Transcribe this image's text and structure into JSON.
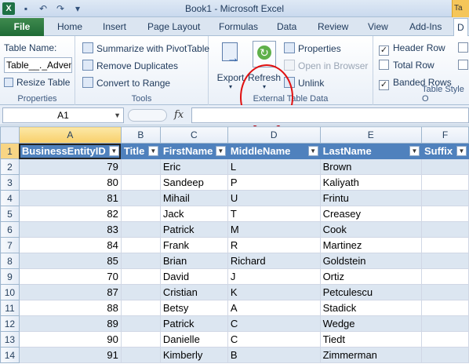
{
  "titlebar": {
    "app_icon": "X",
    "title": "Book1  -  Microsoft Excel",
    "context_tab": "Ta"
  },
  "tabs": {
    "file": "File",
    "items": [
      "Home",
      "Insert",
      "Page Layout",
      "Formulas",
      "Data",
      "Review",
      "View",
      "Add-Ins",
      "D"
    ]
  },
  "ribbon": {
    "properties": {
      "table_name_label": "Table Name:",
      "table_name_value": "Table__._Advent",
      "resize_label": "Resize Table",
      "group_label": "Properties"
    },
    "tools": {
      "summarize": "Summarize with PivotTable",
      "remove_duplicates": "Remove Duplicates",
      "convert": "Convert to Range",
      "group_label": "Tools"
    },
    "external": {
      "export": "Export",
      "refresh": "Refresh",
      "properties": "Properties",
      "open_in_browser": "Open in Browser",
      "unlink": "Unlink",
      "group_label": "External Table Data"
    },
    "style_options": {
      "header_row": "Header Row",
      "total_row": "Total Row",
      "banded_rows": "Banded Rows",
      "group_label": "Table Style O"
    }
  },
  "formula_bar": {
    "name_box": "A1",
    "fx": "fx",
    "formula": ""
  },
  "grid": {
    "columns": [
      "A",
      "B",
      "C",
      "D",
      "E",
      "F"
    ],
    "headers": [
      "BusinessEntityID",
      "Title",
      "FirstName",
      "MiddleName",
      "LastName",
      "Suffix"
    ],
    "rows": [
      {
        "num": "2",
        "cells": [
          "79",
          "",
          "Eric",
          "L",
          "Brown",
          ""
        ]
      },
      {
        "num": "3",
        "cells": [
          "80",
          "",
          "Sandeep",
          "P",
          "Kaliyath",
          ""
        ]
      },
      {
        "num": "4",
        "cells": [
          "81",
          "",
          "Mihail",
          "U",
          "Frintu",
          ""
        ]
      },
      {
        "num": "5",
        "cells": [
          "82",
          "",
          "Jack",
          "T",
          "Creasey",
          ""
        ]
      },
      {
        "num": "6",
        "cells": [
          "83",
          "",
          "Patrick",
          "M",
          "Cook",
          ""
        ]
      },
      {
        "num": "7",
        "cells": [
          "84",
          "",
          "Frank",
          "R",
          "Martinez",
          ""
        ]
      },
      {
        "num": "8",
        "cells": [
          "85",
          "",
          "Brian",
          "Richard",
          "Goldstein",
          ""
        ]
      },
      {
        "num": "9",
        "cells": [
          "70",
          "",
          "David",
          "J",
          "Ortiz",
          ""
        ]
      },
      {
        "num": "10",
        "cells": [
          "87",
          "",
          "Cristian",
          "K",
          "Petculescu",
          ""
        ]
      },
      {
        "num": "11",
        "cells": [
          "88",
          "",
          "Betsy",
          "A",
          "Stadick",
          ""
        ]
      },
      {
        "num": "12",
        "cells": [
          "89",
          "",
          "Patrick",
          "C",
          "Wedge",
          ""
        ]
      },
      {
        "num": "13",
        "cells": [
          "90",
          "",
          "Danielle",
          "C",
          "Tiedt",
          ""
        ]
      },
      {
        "num": "14",
        "cells": [
          "91",
          "",
          "Kimberly",
          "B",
          "Zimmerman",
          ""
        ]
      }
    ]
  },
  "colors": {
    "table_header": "#4f81bd",
    "band": "#dce6f1",
    "annotation_circle": "#e01010"
  }
}
